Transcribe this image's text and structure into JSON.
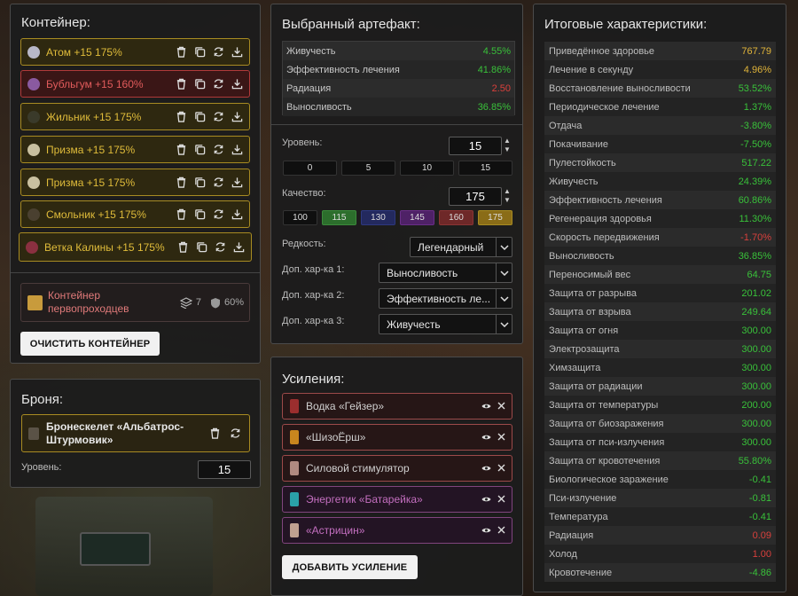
{
  "colors": {
    "accent_gold": "#e0bc3a",
    "positive": "#39c13a",
    "negative": "#d8403c"
  },
  "container": {
    "title": "Контейнер:",
    "slots": [
      {
        "label": "Атом +15 175%",
        "style": "gold",
        "icon": "atom-icon",
        "icon_color": "#b8b8c8"
      },
      {
        "label": "Бубльгум +15 160%",
        "style": "red",
        "icon": "bubblegum-icon",
        "icon_color": "#8a5aa0"
      },
      {
        "label": "Жильник +15 175%",
        "style": "gold",
        "icon": "vein-icon",
        "icon_color": "#3a3a2a"
      },
      {
        "label": "Призма +15 175%",
        "style": "gold",
        "icon": "prism-icon",
        "icon_color": "#c9c0a0"
      },
      {
        "label": "Призма +15 175%",
        "style": "gold",
        "icon": "prism-icon",
        "icon_color": "#c9c0a0"
      },
      {
        "label": "Смольник +15 175%",
        "style": "gold",
        "icon": "resin-icon",
        "icon_color": "#4a4030"
      },
      {
        "label": "Ветка Калины +15 175%",
        "style": "gold",
        "icon": "viburnum-icon",
        "icon_color": "#8a3040"
      }
    ],
    "pioneer": {
      "name": "Контейнер первопроходцев",
      "slots": "7",
      "protection": "60%"
    },
    "clear_button": "ОЧИСТИТЬ КОНТЕЙНЕР"
  },
  "armor": {
    "title": "Броня:",
    "item": "Бронескелет «Альбатрос-Штурмовик»",
    "level_label": "Уровень:",
    "level": "15"
  },
  "artifact": {
    "title": "Выбранный артефакт:",
    "stats": [
      {
        "name": "Живучесть",
        "value": "4.55%",
        "tone": "green"
      },
      {
        "name": "Эффективность лечения",
        "value": "41.86%",
        "tone": "green"
      },
      {
        "name": "Радиация",
        "value": "2.50",
        "tone": "red"
      },
      {
        "name": "Выносливость",
        "value": "36.85%",
        "tone": "green"
      }
    ],
    "level_label": "Уровень:",
    "level": "15",
    "level_presets": [
      "0",
      "5",
      "10",
      "15"
    ],
    "quality_label": "Качество:",
    "quality": "175",
    "quality_presets": [
      {
        "label": "100",
        "bg": "#0f0f0f",
        "border": "#333"
      },
      {
        "label": "115",
        "bg": "#2c6e2c",
        "border": "#3b8a3b"
      },
      {
        "label": "130",
        "bg": "#23295e",
        "border": "#2e3880"
      },
      {
        "label": "145",
        "bg": "#4e2166",
        "border": "#6a2e88"
      },
      {
        "label": "160",
        "bg": "#6e2828",
        "border": "#8a3434"
      },
      {
        "label": "175",
        "bg": "#8a6c17",
        "border": "#a88b22"
      }
    ],
    "rarity_label": "Редкость:",
    "rarity": "Легендарный",
    "extra1_label": "Доп. хар-ка 1:",
    "extra1": "Выносливость",
    "extra2_label": "Доп. хар-ка 2:",
    "extra2": "Эффективность ле...",
    "extra3_label": "Доп. хар-ка 3:",
    "extra3": "Живучесть"
  },
  "boosts": {
    "title": "Усиления:",
    "items": [
      {
        "name": "Водка «Гейзер»",
        "style": "red",
        "icon": "bottle-icon",
        "icon_color": "#9b2e2e"
      },
      {
        "name": "«ШизоЁрш»",
        "style": "red",
        "icon": "bottle-icon",
        "icon_color": "#c8861e"
      },
      {
        "name": "Силовой стимулятор",
        "style": "red",
        "icon": "syringe-icon",
        "icon_color": "#b08a80"
      },
      {
        "name": "Энергетик «Батарейка»",
        "style": "purple",
        "icon": "can-icon",
        "icon_color": "#2aa0a8"
      },
      {
        "name": "«Астрицин»",
        "style": "purple",
        "icon": "pill-icon",
        "icon_color": "#c0a090"
      }
    ],
    "add_button": "ДОБАВИТЬ УСИЛЕНИЕ"
  },
  "totals": {
    "title": "Итоговые характеристики:",
    "rows": [
      {
        "name": "Приведённое здоровье",
        "value": "767.79",
        "tone": "gold"
      },
      {
        "name": "Лечение в секунду",
        "value": "4.96%",
        "tone": "gold"
      },
      {
        "name": "Восстановление выносливости",
        "value": "53.52%",
        "tone": "green"
      },
      {
        "name": "Периодическое лечение",
        "value": "1.37%",
        "tone": "green"
      },
      {
        "name": "Отдача",
        "value": "-3.80%",
        "tone": "green"
      },
      {
        "name": "Покачивание",
        "value": "-7.50%",
        "tone": "green"
      },
      {
        "name": "Пулестойкость",
        "value": "517.22",
        "tone": "green"
      },
      {
        "name": "Живучесть",
        "value": "24.39%",
        "tone": "green"
      },
      {
        "name": "Эффективность лечения",
        "value": "60.86%",
        "tone": "green"
      },
      {
        "name": "Регенерация здоровья",
        "value": "11.30%",
        "tone": "green"
      },
      {
        "name": "Скорость передвижения",
        "value": "-1.70%",
        "tone": "red"
      },
      {
        "name": "Выносливость",
        "value": "36.85%",
        "tone": "green"
      },
      {
        "name": "Переносимый вес",
        "value": "64.75",
        "tone": "green"
      },
      {
        "name": "Защита от разрыва",
        "value": "201.02",
        "tone": "green"
      },
      {
        "name": "Защита от взрыва",
        "value": "249.64",
        "tone": "green"
      },
      {
        "name": "Защита от огня",
        "value": "300.00",
        "tone": "green"
      },
      {
        "name": "Электрозащита",
        "value": "300.00",
        "tone": "green"
      },
      {
        "name": "Химзащита",
        "value": "300.00",
        "tone": "green"
      },
      {
        "name": "Защита от радиации",
        "value": "300.00",
        "tone": "green"
      },
      {
        "name": "Защита от температуры",
        "value": "200.00",
        "tone": "green"
      },
      {
        "name": "Защита от биозаражения",
        "value": "300.00",
        "tone": "green"
      },
      {
        "name": "Защита от пси-излучения",
        "value": "300.00",
        "tone": "green"
      },
      {
        "name": "Защита от кровотечения",
        "value": "55.80%",
        "tone": "green"
      },
      {
        "name": "Биологическое заражение",
        "value": "-0.41",
        "tone": "green"
      },
      {
        "name": "Пси-излучение",
        "value": "-0.81",
        "tone": "green"
      },
      {
        "name": "Температура",
        "value": "-0.41",
        "tone": "green"
      },
      {
        "name": "Радиация",
        "value": "0.09",
        "tone": "red"
      },
      {
        "name": "Холод",
        "value": "1.00",
        "tone": "red"
      },
      {
        "name": "Кровотечение",
        "value": "-4.86",
        "tone": "green"
      }
    ]
  }
}
